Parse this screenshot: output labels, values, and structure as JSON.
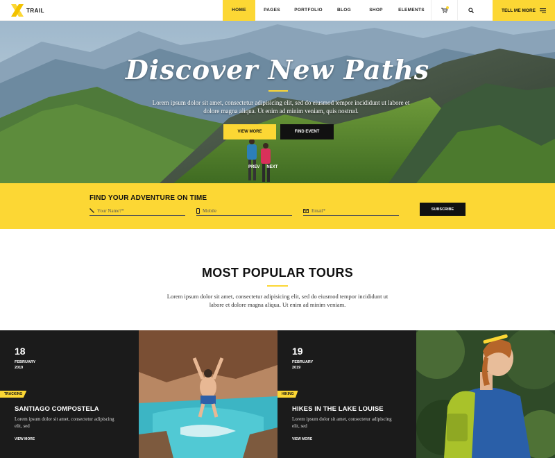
{
  "brand": {
    "logo_text": "TRAIL",
    "accent": "#fcd734",
    "dark": "#1b1b1b"
  },
  "nav": {
    "items": [
      {
        "label": "HOME",
        "active": true
      },
      {
        "label": "PAGES",
        "active": false
      },
      {
        "label": "PORTFOLIO",
        "active": false
      },
      {
        "label": "BLOG",
        "active": false
      },
      {
        "label": "SHOP",
        "active": false
      },
      {
        "label": "ELEMENTS",
        "active": false
      }
    ],
    "cart_icon": "cart-icon",
    "search_icon": "search-icon",
    "tell_me_label": "TELL ME MORE",
    "tell_me_icon": "menu-lines-icon"
  },
  "hero": {
    "title": "Discover New Paths",
    "text": "Lorem ipsum dolor sit amet, consectetur adipisicing elit, sed do eiusmod tempor incididunt ut labore et dolore magna aliqua. Ut enim ad minim veniam, quis nostrud.",
    "view_more_label": "VIEW MORE",
    "find_event_label": "FIND EVENT",
    "prev_label": "PREV",
    "next_label": "NEXT"
  },
  "subscribe": {
    "title": "FIND YOUR ADVENTURE ON TIME",
    "name_placeholder": "Your Name?*",
    "mobile_placeholder": "Mobile",
    "email_placeholder": "Email*",
    "button_label": "SUBSCRIBE"
  },
  "popular": {
    "title": "MOST POPULAR TOURS",
    "text": "Lorem ipsum dolor sit amet, consectetur adipisicing elit, sed do eiusmod tempor incididunt ut labore et dolore magna aliqua. Ut enim ad minim veniam."
  },
  "tours": [
    {
      "day": "18",
      "month": "FEBRUARY",
      "year": "2019",
      "tag": "TRACKING",
      "name": "SANTIAGO COMPOSTELA",
      "desc": "Lorem ipsum dolor sit amet, consectetur adipiscing elit, sed",
      "more_label": "VIEW MORE"
    },
    {
      "day": "19",
      "month": "FEBRUARY",
      "year": "2019",
      "tag": "HIKING",
      "name": "HIKES IN THE LAKE LOUISE",
      "desc": "Lorem ipsum dolor sit amet, consectetur adipiscing elit, sed",
      "more_label": "VIEW MORE"
    }
  ]
}
